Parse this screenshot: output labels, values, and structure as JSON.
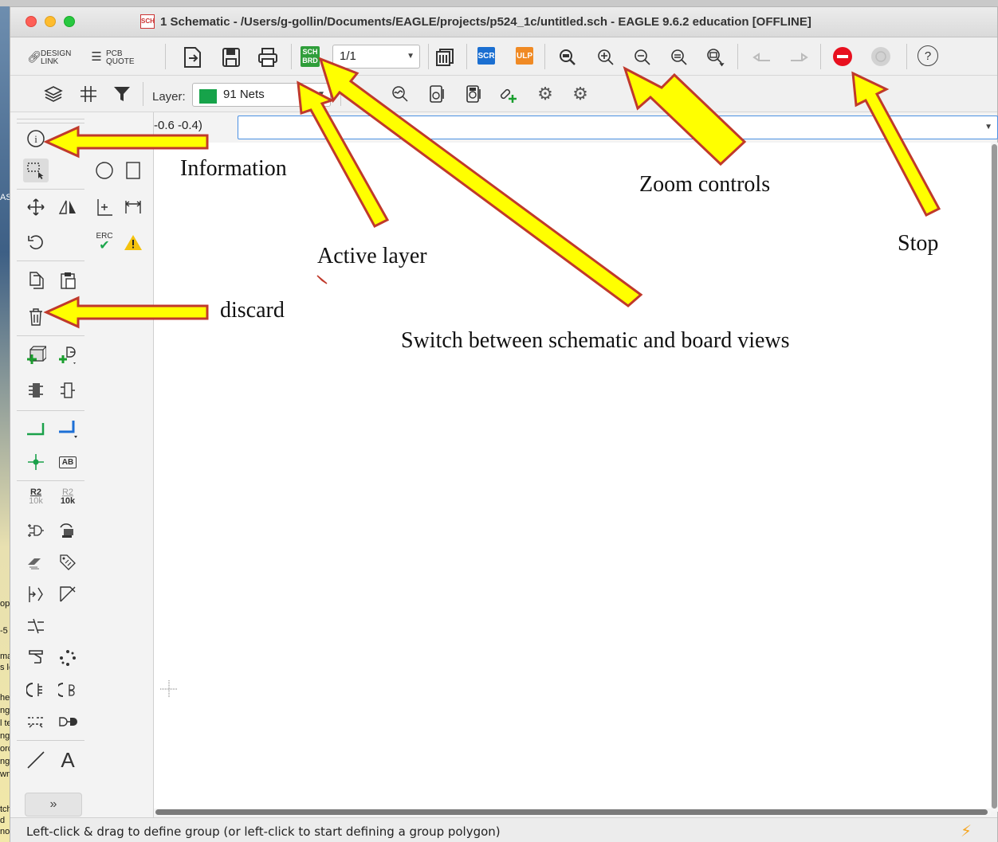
{
  "window": {
    "title": "1 Schematic - /Users/g-gollin/Documents/EAGLE/projects/p524_1c/untitled.sch - EAGLE 9.6.2 education [OFFLINE]",
    "title_icon": "SCH"
  },
  "toolbar": {
    "design_link_top": "DESIGN",
    "design_link_bottom": "LINK",
    "pcb_quote_top": "PCB",
    "pcb_quote_bottom": "QUOTE",
    "switch_top": "SCH",
    "switch_bottom": "BRD",
    "sheet_value": "1/1",
    "scr_label": "SCR",
    "ulp_label": "ULP",
    "help_label": "?"
  },
  "toolbar2": {
    "layer_label": "Layer:",
    "layer_value": "91 Nets",
    "layer_color": "#16a34a"
  },
  "palette": {
    "erc_label": "ERC",
    "name_top": "R2",
    "name_bottom": "10k",
    "value_top": "R2",
    "value_bottom": "10k",
    "label_ab": "AB",
    "text_tool": "A",
    "more": "»"
  },
  "canvas": {
    "coordinates": "-0.6 -0.4)"
  },
  "status": {
    "text": "Left-click & drag to define group (or left-click to start defining a group polygon)"
  },
  "annotations": {
    "information": "Information",
    "zoom_controls": "Zoom controls",
    "stop": "Stop",
    "active_layer": "Active layer",
    "discard": "discard",
    "switch_views": "Switch between schematic and board views"
  },
  "desktop": {
    "frag_1": "ASS",
    "frag_2": "opt",
    "frag_3": "-5",
    "frag_4": "ma",
    "frag_5": "s le",
    "frag_6": "he:",
    "frag_7": "ng c",
    "frag_8": "l te",
    "frag_9": "ng c",
    "frag_10": "ord",
    "frag_11": "ng c",
    "frag_12": "wn.",
    "frag_13": "tch",
    "frag_14": "d",
    "frag_15": "not"
  },
  "colors": {
    "arrow_fill": "#ffff00",
    "arrow_stroke": "#c0392b",
    "stop_red": "#e8101f"
  }
}
